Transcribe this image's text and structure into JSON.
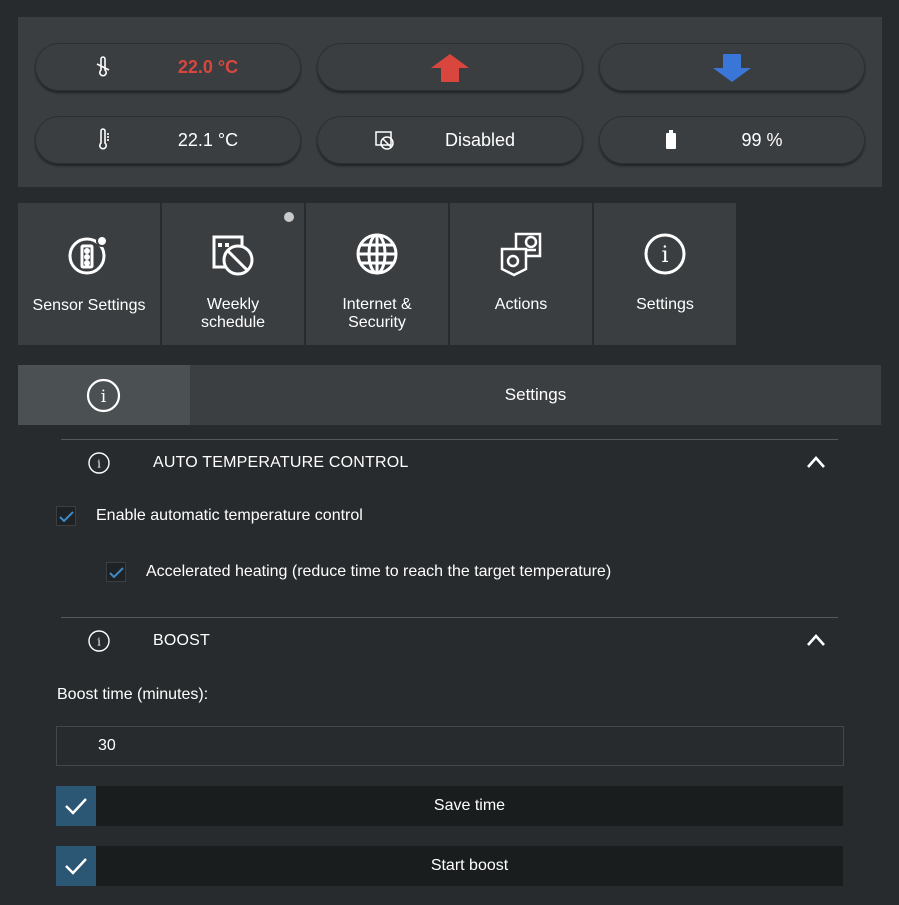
{
  "status": {
    "target_temp": "22.0 °C",
    "current_temp": "22.1 °C",
    "schedule_state": "Disabled",
    "battery": "99 %",
    "colors": {
      "target": "#d9463e",
      "up_arrow": "#d9463e",
      "down_arrow": "#3a76d8"
    }
  },
  "tiles": [
    {
      "label": "Sensor Settings",
      "icon": "sensor-settings-icon"
    },
    {
      "label": "Weekly schedule",
      "icon": "weekly-schedule-icon"
    },
    {
      "label": "Internet & Security",
      "icon": "globe-icon"
    },
    {
      "label": "Actions",
      "icon": "actions-icon"
    },
    {
      "label": "Settings",
      "icon": "info-icon"
    }
  ],
  "tabbar": {
    "title": "Settings"
  },
  "sections": {
    "auto": {
      "title": "AUTO TEMPERATURE CONTROL",
      "enable_label": "Enable automatic temperature control",
      "accelerated_label": "Accelerated heating (reduce time to reach the target temperature)"
    },
    "boost": {
      "title": "BOOST",
      "time_label": "Boost time (minutes):",
      "time_value": "30",
      "save_label": "Save time",
      "start_label": "Start boost"
    }
  },
  "accent_color": "#2c5774"
}
